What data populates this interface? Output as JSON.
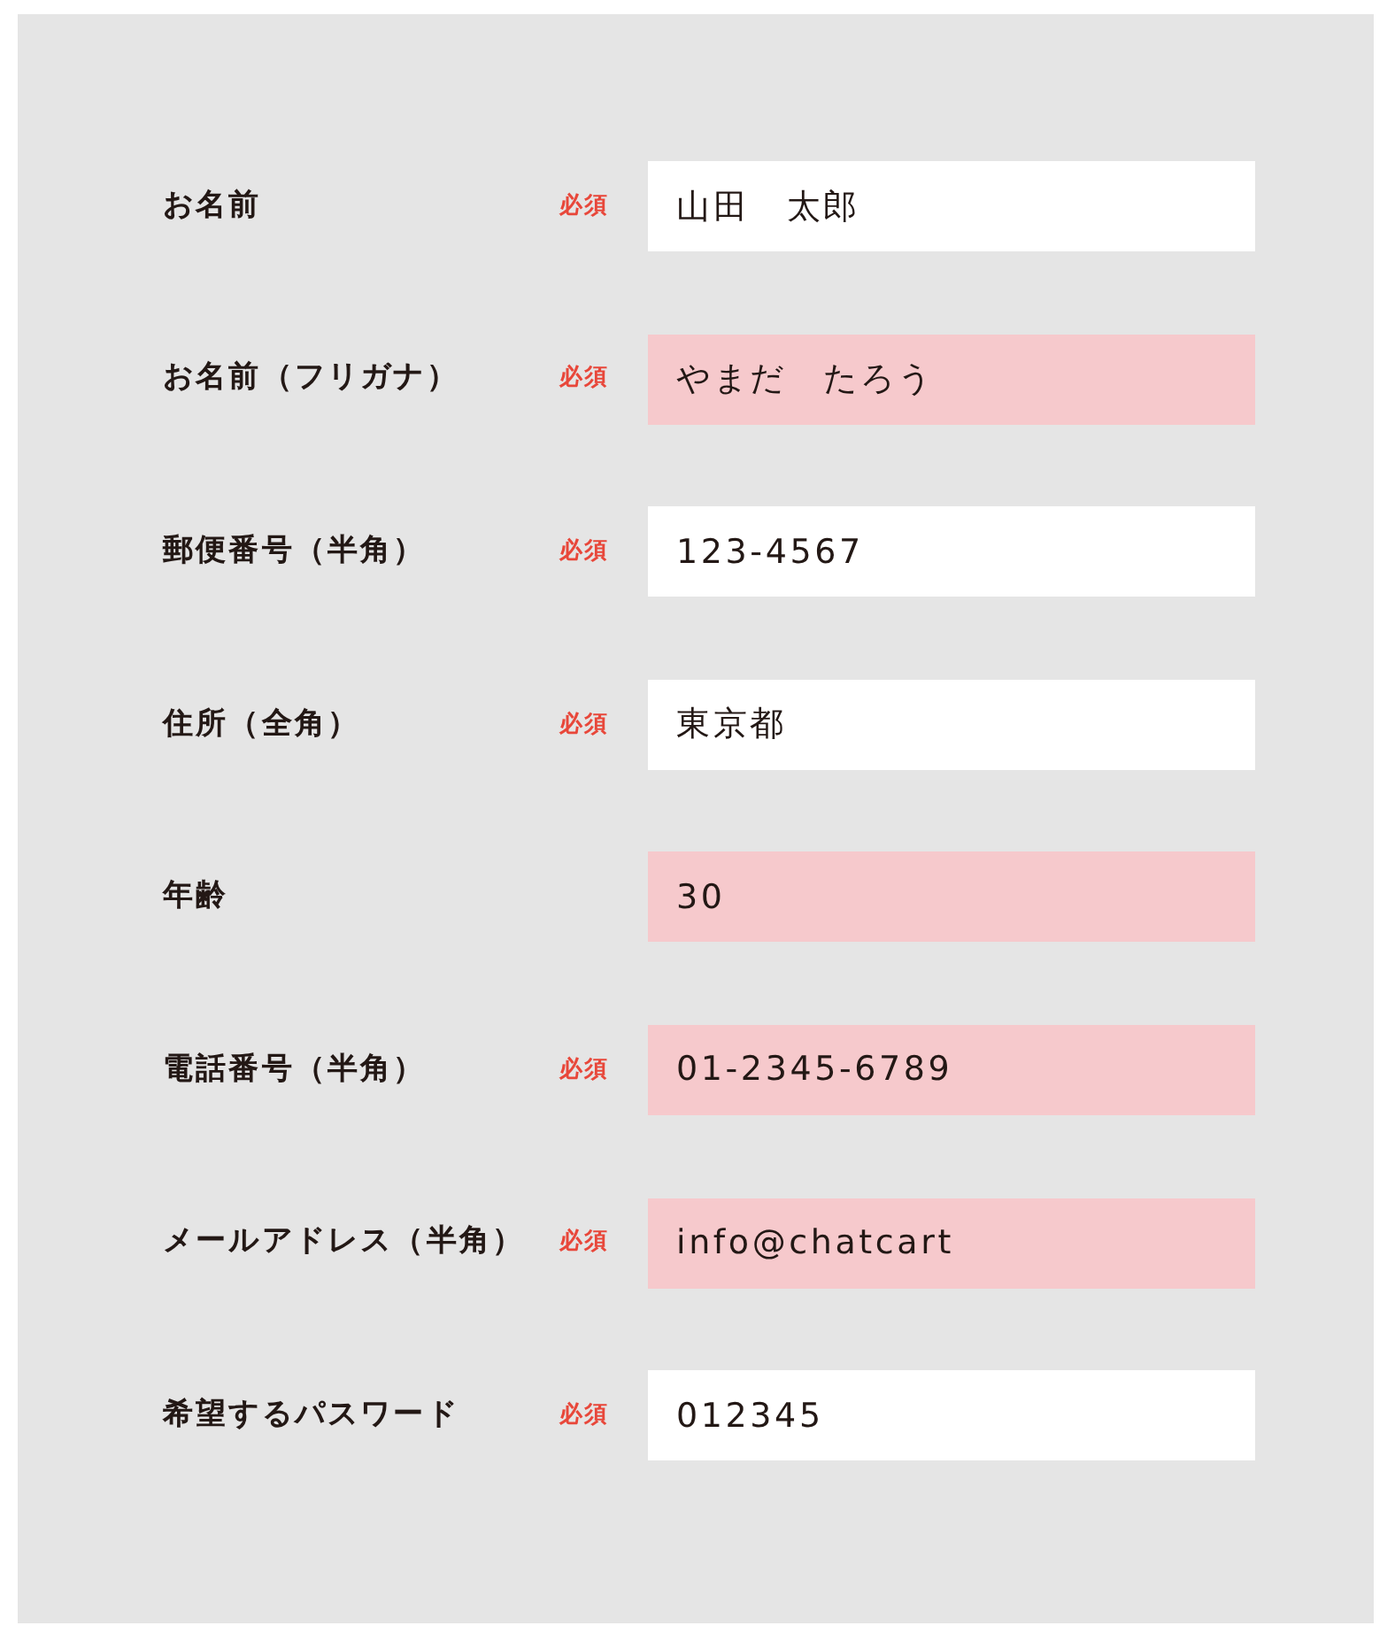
{
  "form": {
    "fields": [
      {
        "label": "お名前",
        "required_mark": "必須",
        "value": "山田　太郎",
        "highlighted": false
      },
      {
        "label": "お名前（フリガナ）",
        "required_mark": "必須",
        "value": "やまだ　たろう",
        "highlighted": true
      },
      {
        "label": "郵便番号（半角）",
        "required_mark": "必須",
        "value": "123-4567",
        "highlighted": false
      },
      {
        "label": "住所（全角）",
        "required_mark": "必須",
        "value": "東京都",
        "highlighted": false
      },
      {
        "label": "年齢",
        "value": "30",
        "highlighted": true
      },
      {
        "label": "電話番号（半角）",
        "required_mark": "必須",
        "value": "01-2345-6789",
        "highlighted": true
      },
      {
        "label": "メールアドレス（半角）",
        "required_mark": "必須",
        "value": "info@chatcart",
        "highlighted": true
      },
      {
        "label": "希望するパスワード",
        "required_mark": "必須",
        "value": "012345",
        "highlighted": false
      }
    ]
  }
}
